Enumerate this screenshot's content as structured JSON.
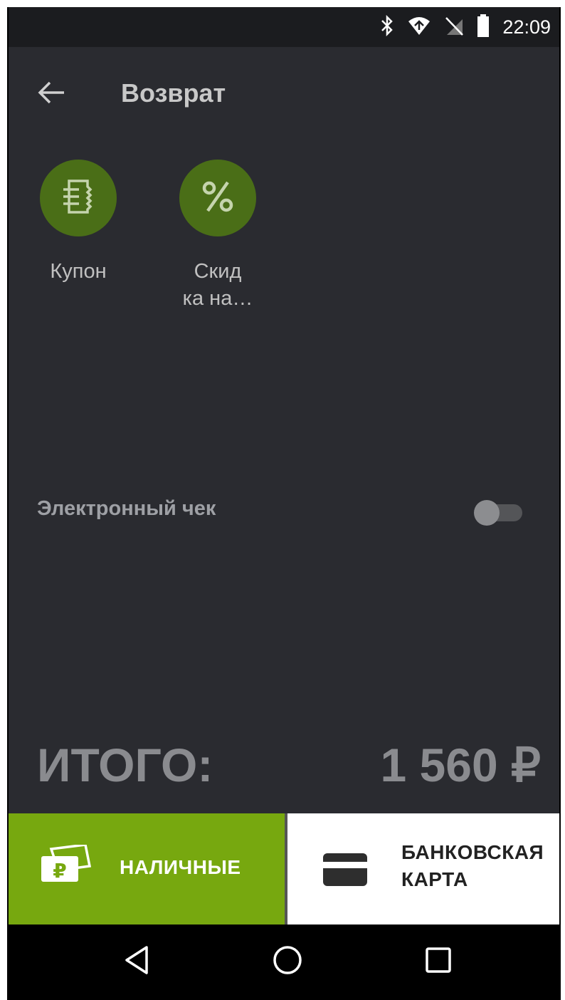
{
  "status_bar": {
    "time": "22:09",
    "icons": [
      "bluetooth-icon",
      "wifi-icon",
      "no-sim-icon",
      "battery-icon"
    ]
  },
  "app_bar": {
    "title": "Возврат",
    "back_icon": "arrow-left-icon"
  },
  "actions": [
    {
      "label": "Купон",
      "icon": "coupon-receipt-icon"
    },
    {
      "label": "Скид\nка на…",
      "icon": "percent-icon"
    }
  ],
  "e_receipt": {
    "label": "Электронный чек",
    "enabled": false
  },
  "total": {
    "label": "ИТОГО:",
    "value": "1 560 ₽"
  },
  "payment": {
    "cash_label": "НАЛИЧНЫЕ",
    "card_label": "БАНКОВСКАЯ КАРТА"
  },
  "nav_bar": {
    "buttons": [
      "back-triangle-icon",
      "home-circle-icon",
      "recents-square-icon"
    ]
  },
  "colors": {
    "background": "#2a2b30",
    "accent_green": "#77a80f",
    "icon_circle": "#4a6e17"
  }
}
